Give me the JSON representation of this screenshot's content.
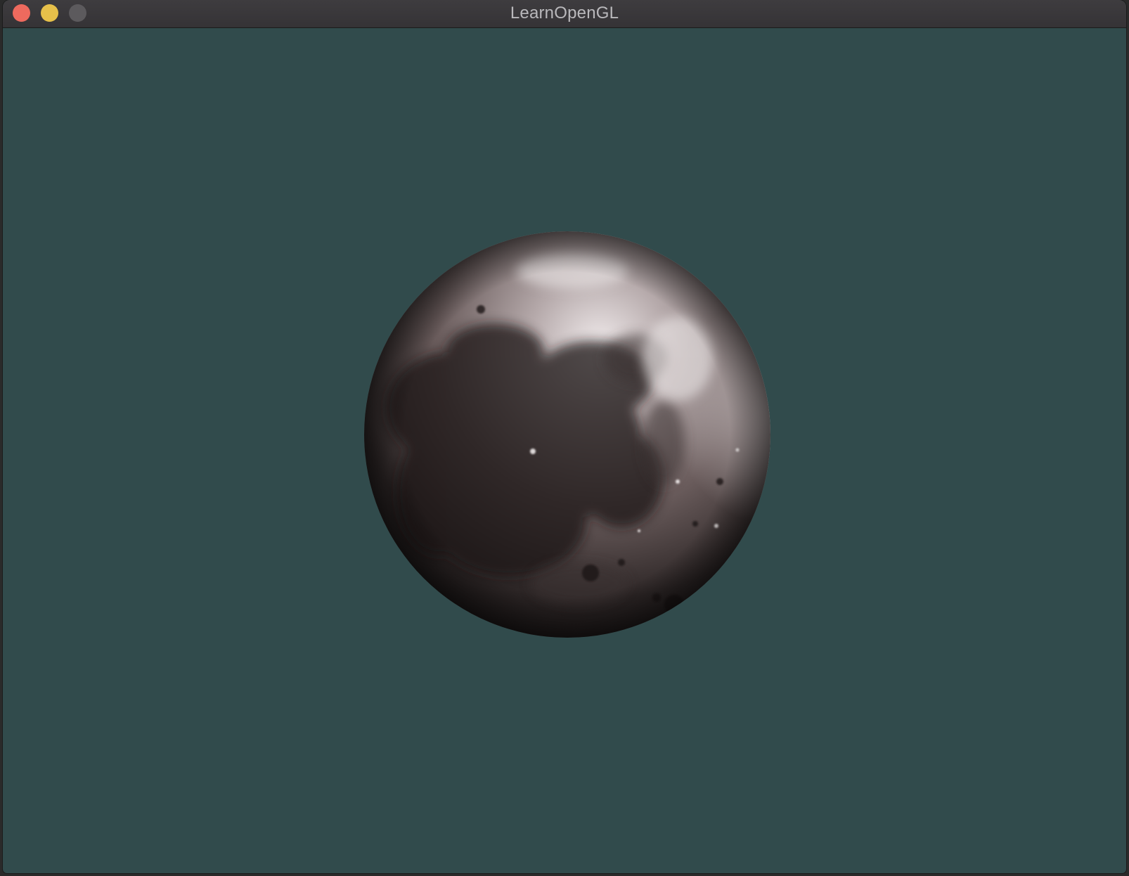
{
  "window": {
    "title": "LearnOpenGL",
    "controls": {
      "close_icon": "close-icon",
      "minimize_icon": "minimize-icon",
      "zoom_icon": "zoom-icon"
    }
  },
  "scene": {
    "clear_color": "#314b4c",
    "object": "moon-sphere"
  }
}
